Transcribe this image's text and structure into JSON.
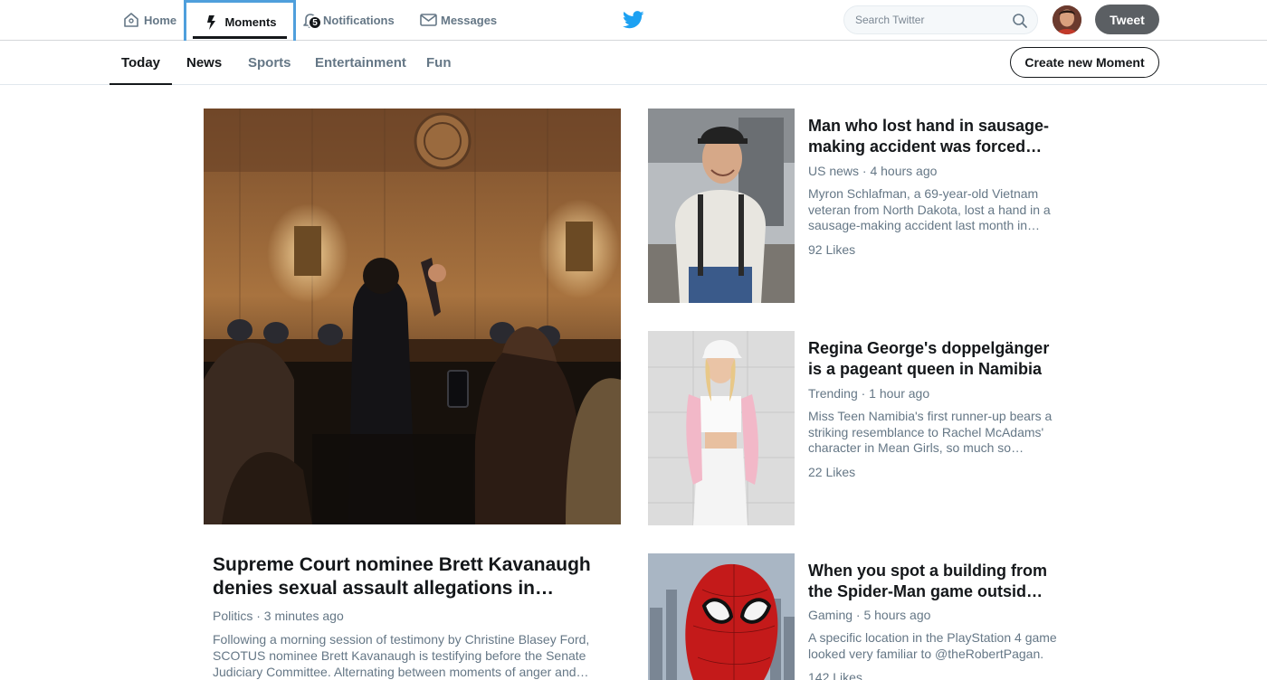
{
  "nav": {
    "home": "Home",
    "moments": "Moments",
    "notifications": "Notifications",
    "notifications_count": "5",
    "messages": "Messages"
  },
  "search": {
    "placeholder": "Search Twitter"
  },
  "tweet_button": "Tweet",
  "tabs": [
    {
      "label": "Today",
      "active": true
    },
    {
      "label": "News"
    },
    {
      "label": "Sports"
    },
    {
      "label": "Entertainment"
    },
    {
      "label": "Fun"
    }
  ],
  "create_moment_button": "Create new Moment",
  "feature": {
    "title": "Supreme Court nominee Brett Kavanaugh denies sexual assault allegations in…",
    "meta": "Politics · 3 minutes ago",
    "description": "Following a morning session of testimony by Christine Blasey Ford, SCOTUS nominee Brett Kavanaugh is testifying before the Senate Judiciary Committee. Alternating between moments of anger and…"
  },
  "cards": [
    {
      "title": "Man who lost hand in sausage-making accident was forced…",
      "meta": "US news · 4 hours ago",
      "description": "Myron Schlafman, a 69-year-old Vietnam veteran from North Dakota, lost a hand in a sausage-making accident last month in…",
      "likes": "92 Likes"
    },
    {
      "title": "Regina George's doppelgänger is a pageant queen in Namibia",
      "meta": "Trending · 1 hour ago",
      "description": "Miss Teen Namibia's first runner-up bears a striking resemblance to Rachel McAdams' character in Mean Girls, so much so…",
      "likes": "22 Likes"
    },
    {
      "title": "When you spot a building from the Spider-Man game outsid…",
      "meta": "Gaming · 5 hours ago",
      "description": "A specific location in the PlayStation 4 game looked very familiar to @theRobertPagan.",
      "likes": "142 Likes"
    }
  ],
  "colors": {
    "twitter_blue": "#1da1f2",
    "text_primary": "#14171a",
    "text_secondary": "#657786",
    "highlight_border": "#4f9fdc"
  },
  "icons": {
    "home": "home-icon",
    "moments": "lightning-icon",
    "notifications": "bell-icon",
    "messages": "envelope-icon",
    "logo": "twitter-bird-icon",
    "search": "search-icon"
  }
}
